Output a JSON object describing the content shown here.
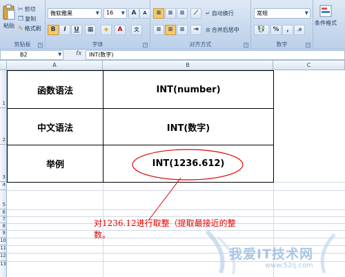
{
  "ribbon": {
    "clipboard": {
      "paste_label": "粘贴",
      "cut_label": "剪切",
      "copy_label": "复制",
      "format_painter_label": "格式刷",
      "group_label": "剪贴板"
    },
    "font": {
      "font_name": "微软雅黑",
      "font_size": "16",
      "group_label": "字体"
    },
    "alignment": {
      "wrap_label": "自动换行",
      "merge_label": "合并后居中",
      "group_label": "对齐方式"
    },
    "number": {
      "format": "常规",
      "group_label": "数字"
    },
    "styles": {
      "conditional_label": "条件格式"
    }
  },
  "formula_bar": {
    "name_box": "B2",
    "fx": "fx",
    "content": "INT(数字)"
  },
  "columns": [
    "A",
    "B",
    "C"
  ],
  "rows": [
    "1",
    "2",
    "3",
    "4",
    "5",
    "6",
    "7",
    "8",
    "9",
    "10",
    "11",
    "12",
    "13"
  ],
  "table": {
    "rows": [
      {
        "label": "函数语法",
        "value": "INT(number)"
      },
      {
        "label": "中文语法",
        "value": "INT(数字)"
      },
      {
        "label": "举例",
        "value": "INT(1236.612)"
      }
    ]
  },
  "annotation": {
    "text": "对1236.12进行取整（提取最接近的整数。"
  },
  "watermark": {
    "text": "我爱IT技术网",
    "url": "www.52ij.com"
  },
  "colors": {
    "annotation_red": "#e00000",
    "ribbon_blue": "#c8d9ee"
  }
}
